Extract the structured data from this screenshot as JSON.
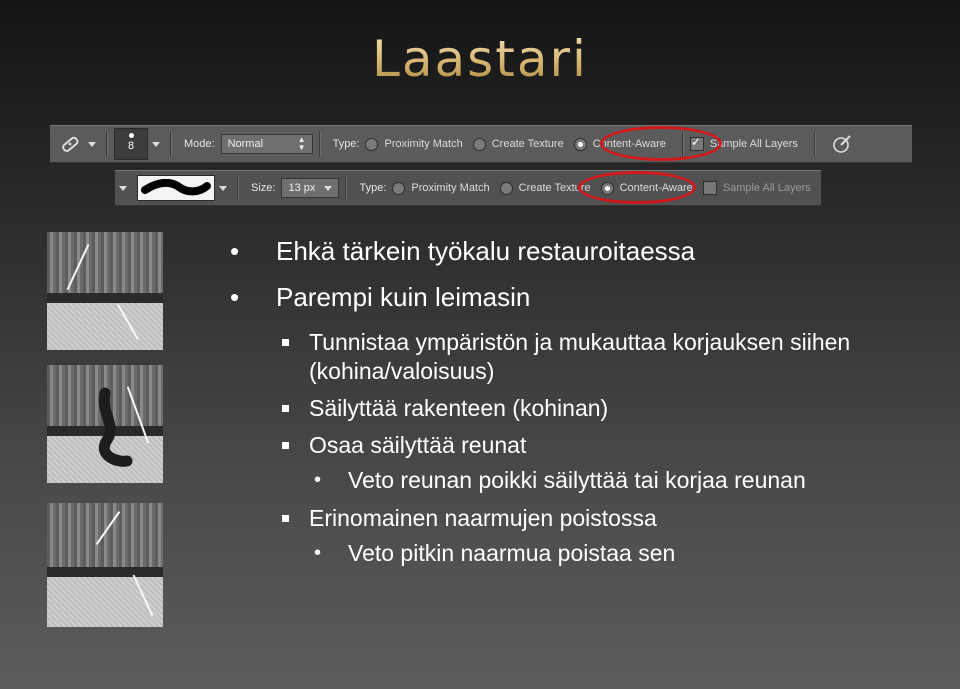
{
  "slide": {
    "title": "Laastari",
    "bullets": [
      "Ehkä tärkein työkalu restauroitaessa",
      "Parempi kuin leimasin",
      "Tunnistaa ympäristön ja mukauttaa korjauksen siihen (kohina/valoisuus)",
      "Säilyttää rakenteen (kohinan)",
      "Osaa säilyttää reunat",
      "Veto reunan poikki säilyttää tai korjaa reunan",
      "Erinomainen naarmujen poistossa",
      "Veto pitkin naarmua poistaa sen"
    ]
  },
  "toolbar1": {
    "brush_size": "8",
    "mode_label": "Mode:",
    "mode_value": "Normal",
    "type_label": "Type:",
    "opt_proximity": "Proximity Match",
    "opt_texture": "Create Texture",
    "opt_content": "Content-Aware",
    "sample_all": "Sample All Layers",
    "sample_all_checked": true,
    "selected_type": "Content-Aware"
  },
  "toolbar2": {
    "size_label": "Size:",
    "size_value": "13 px",
    "type_label": "Type:",
    "opt_proximity": "Proximity Match",
    "opt_texture": "Create Texture",
    "opt_content": "Content-Aware",
    "sample_all": "Sample All Layers",
    "sample_all_checked": false,
    "selected_type": "Content-Aware"
  },
  "colors": {
    "highlight": "#d1191c",
    "title_gold": "#e8cf93"
  }
}
